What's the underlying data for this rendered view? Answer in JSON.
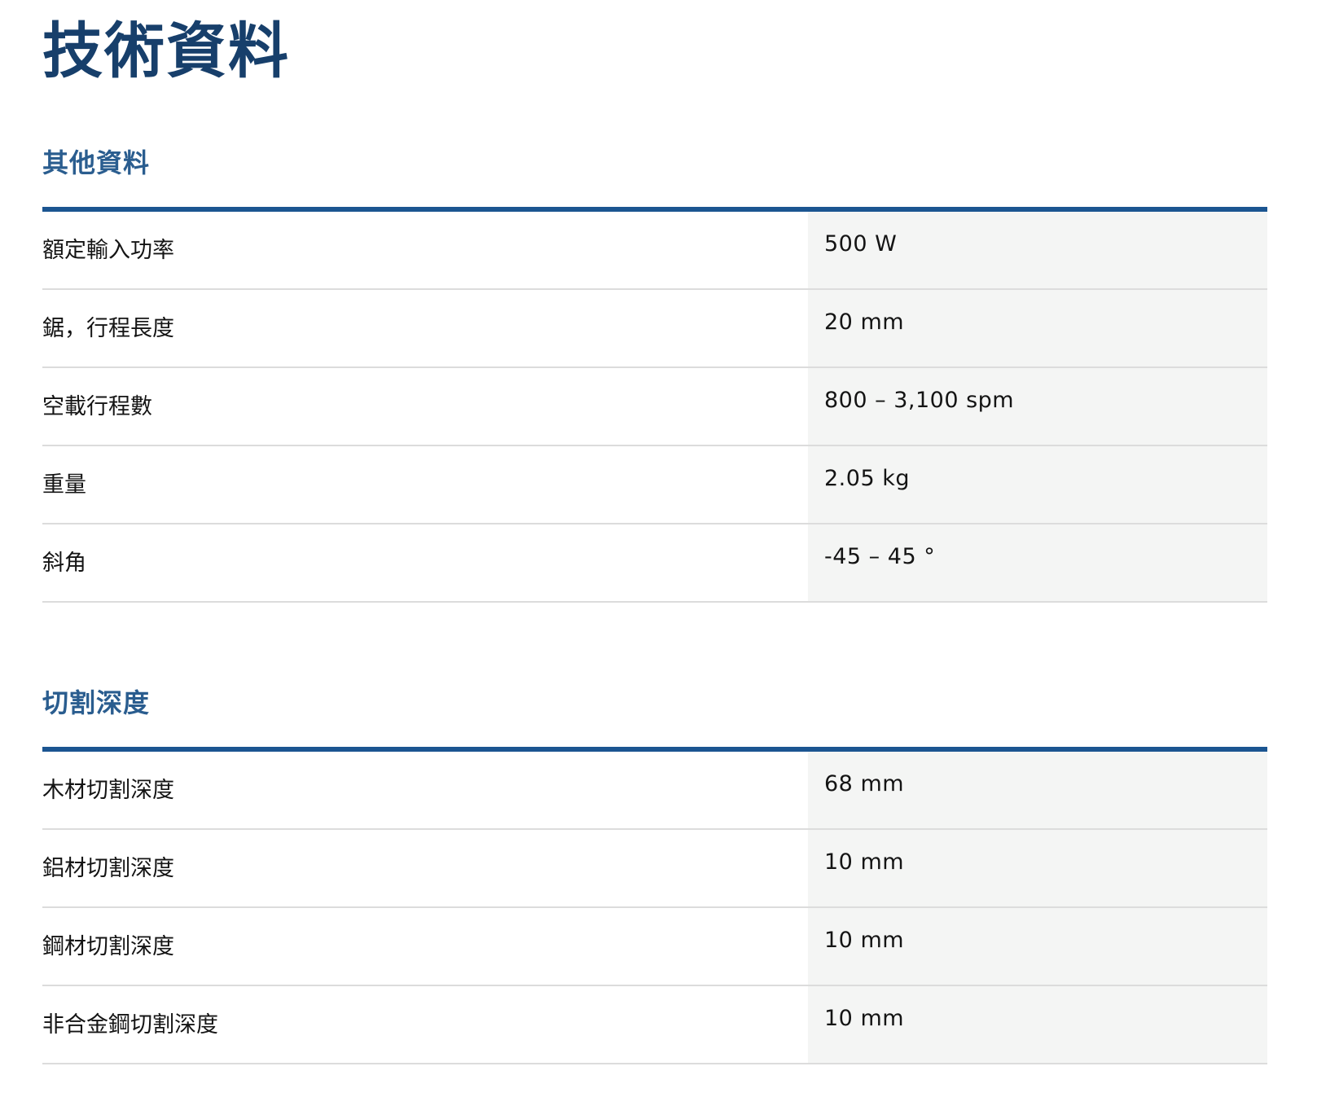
{
  "page": {
    "title": "技術資料"
  },
  "sections": [
    {
      "title": "其他資料",
      "rows": [
        {
          "label": "額定輸入功率",
          "value": "500 W"
        },
        {
          "label": "鋸，行程長度",
          "value": "20 mm"
        },
        {
          "label": "空載行程數",
          "value": "800 – 3,100 spm"
        },
        {
          "label": "重量",
          "value": "2.05 kg"
        },
        {
          "label": "斜角",
          "value": "-45 – 45 °"
        }
      ]
    },
    {
      "title": "切割深度",
      "rows": [
        {
          "label": "木材切割深度",
          "value": "68 mm"
        },
        {
          "label": "鋁材切割深度",
          "value": "10 mm"
        },
        {
          "label": "鋼材切割深度",
          "value": "10 mm"
        },
        {
          "label": "非合金鋼切割深度",
          "value": "10 mm"
        }
      ]
    }
  ],
  "colors": {
    "title": "#173f6b",
    "section_title": "#2a5d8f",
    "table_rule": "#1b5591",
    "value_background": "#f4f5f4",
    "row_divider": "#dcdcdc"
  }
}
